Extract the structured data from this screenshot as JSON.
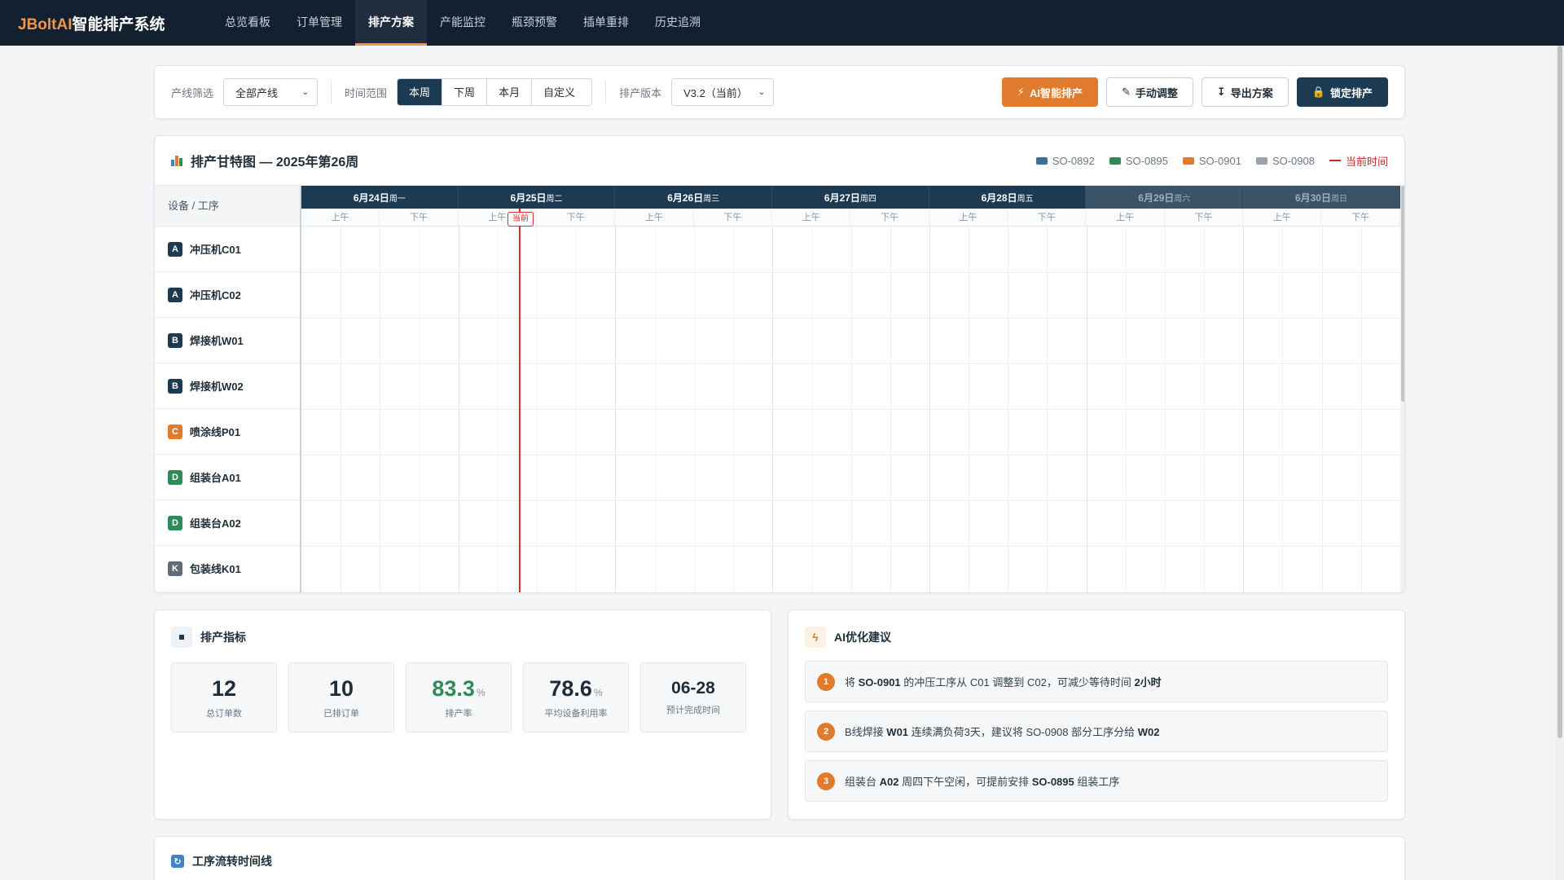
{
  "brand": {
    "prefix": "JBoltAI",
    "suffix": "智能排产系统"
  },
  "nav": [
    "总览看板",
    "订单管理",
    "排产方案",
    "产能监控",
    "瓶颈预警",
    "插单重排",
    "历史追溯"
  ],
  "toolbar": {
    "line_label": "产线筛选",
    "line_value": "全部产线",
    "range_label": "时间范围",
    "range_options": [
      "本周",
      "下周",
      "本月",
      "自定义"
    ],
    "version_label": "排产版本",
    "version_value": "V3.2（当前）",
    "btn_ai": "AI智能排产",
    "btn_manual": "手动调整",
    "btn_export": "导出方案",
    "btn_lock": "锁定排产"
  },
  "gantt": {
    "title": "排产甘特图 — 2025年第26周",
    "legend": [
      {
        "label": "SO-0892",
        "color": "#3c6e97"
      },
      {
        "label": "SO-0895",
        "color": "#2e8b57"
      },
      {
        "label": "SO-0901",
        "color": "#e07b2e"
      },
      {
        "label": "SO-0908",
        "color": "#9aa3ab"
      }
    ],
    "now_legend": "当前时间",
    "device_header": "设备 / 工序",
    "days": [
      {
        "date": "6月24日",
        "weekday": "周一",
        "weekend": false
      },
      {
        "date": "6月25日",
        "weekday": "周二",
        "weekend": false
      },
      {
        "date": "6月26日",
        "weekday": "周三",
        "weekend": false
      },
      {
        "date": "6月27日",
        "weekday": "周四",
        "weekend": false
      },
      {
        "date": "6月28日",
        "weekday": "周五",
        "weekend": false
      },
      {
        "date": "6月29日",
        "weekday": "周六",
        "weekend": true
      },
      {
        "date": "6月30日",
        "weekday": "周日",
        "weekend": true
      }
    ],
    "am": "上午",
    "pm": "下午",
    "now_tag": "当前",
    "devices": [
      {
        "code": "A",
        "name": "冲压机C01",
        "color": "#1c3a52"
      },
      {
        "code": "A",
        "name": "冲压机C02",
        "color": "#1c3a52"
      },
      {
        "code": "B",
        "name": "焊接机W01",
        "color": "#1c3a52"
      },
      {
        "code": "B",
        "name": "焊接机W02",
        "color": "#1c3a52"
      },
      {
        "code": "C",
        "name": "喷涂线P01",
        "color": "#e07b2e"
      },
      {
        "code": "D",
        "name": "组装台A01",
        "color": "#2e8b57"
      },
      {
        "code": "D",
        "name": "组装台A02",
        "color": "#2e8b57"
      },
      {
        "code": "K",
        "name": "包装线K01",
        "color": "#5f6b76"
      }
    ]
  },
  "metrics": {
    "title": "排产指标",
    "items": [
      {
        "value": "12",
        "unit": "",
        "label": "总订单数"
      },
      {
        "value": "10",
        "unit": "",
        "label": "已排订单"
      },
      {
        "value": "83.3",
        "unit": "%",
        "label": "排产率"
      },
      {
        "value": "78.6",
        "unit": "%",
        "label": "平均设备利用率"
      },
      {
        "value": "06-28",
        "unit": "",
        "label": "预计完成时间"
      }
    ]
  },
  "ai": {
    "title": "AI优化建议",
    "suggestions": [
      {
        "n": "1",
        "parts": [
          "将 ",
          "SO-0901",
          " 的冲压工序从 C01 调整到 C02，可减少等待时间 ",
          "2小时",
          ""
        ]
      },
      {
        "n": "2",
        "parts": [
          "B线焊接 ",
          "W01",
          " 连续满负荷3天，建议将 SO-0908 部分工序分给 ",
          "W02",
          ""
        ]
      },
      {
        "n": "3",
        "parts": [
          "组装台 ",
          "A02",
          " 周四下午空闲，可提前安排 ",
          "SO-0895",
          " 组装工序"
        ]
      }
    ]
  },
  "flow": {
    "title": "工序流转时间线"
  }
}
